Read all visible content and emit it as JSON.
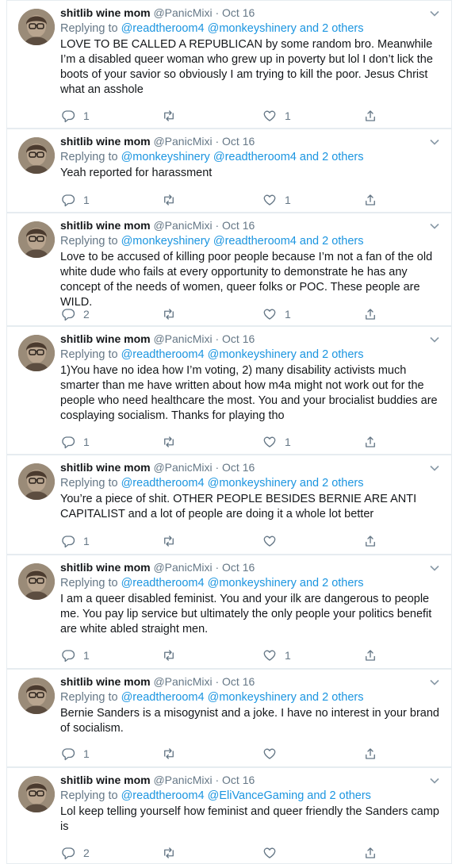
{
  "tweets": [
    {
      "name": "shitlib wine mom",
      "handle": "@PanicMixi",
      "sep": "·",
      "date": "Oct 16",
      "replying_prefix": "Replying to",
      "replying_1": "@readtheroom4",
      "replying_2": "@monkeyshinery",
      "replying_and": "and",
      "replying_others": "2 others",
      "text": "LOVE TO BE CALLED A REPUBLICAN by some random bro. Meanwhile I’m a disabled queer woman who grew up in poverty but lol I don’t lick the boots of your savior so obviously I am trying to kill the poor. Jesus Christ what an asshole",
      "reply_count": "1",
      "retweet_count": "",
      "like_count": "1"
    },
    {
      "name": "shitlib wine mom",
      "handle": "@PanicMixi",
      "sep": "·",
      "date": "Oct 16",
      "replying_prefix": "Replying to",
      "replying_1": "@monkeyshinery",
      "replying_2": "@readtheroom4",
      "replying_and": "and",
      "replying_others": "2 others",
      "text": "Yeah reported for harassment",
      "reply_count": "1",
      "retweet_count": "",
      "like_count": "1"
    },
    {
      "name": "shitlib wine mom",
      "handle": "@PanicMixi",
      "sep": "·",
      "date": "Oct 16",
      "replying_prefix": "Replying to",
      "replying_1": "@monkeyshinery",
      "replying_2": "@readtheroom4",
      "replying_and": "and",
      "replying_others": "2 others",
      "text": "Love to be accused of killing poor people because I’m not a fan of the old white dude who fails at every opportunity to demonstrate he has any concept of the needs of women, queer folks or POC. These people are WILD.",
      "reply_count": "2",
      "retweet_count": "",
      "like_count": "1"
    },
    {
      "name": "shitlib wine mom",
      "handle": "@PanicMixi",
      "sep": "·",
      "date": "Oct 16",
      "replying_prefix": "Replying to",
      "replying_1": "@readtheroom4",
      "replying_2": "@monkeyshinery",
      "replying_and": "and",
      "replying_others": "2 others",
      "text": "1)You have no idea how I’m voting, 2) many disability activists much smarter than me have written about how m4a might not work out for the people who need healthcare the most. You and your brocialist buddies are cosplaying socialism. Thanks for playing tho",
      "reply_count": "1",
      "retweet_count": "",
      "like_count": "1"
    },
    {
      "name": "shitlib wine mom",
      "handle": "@PanicMixi",
      "sep": "·",
      "date": "Oct 16",
      "replying_prefix": "Replying to",
      "replying_1": "@readtheroom4",
      "replying_2": "@monkeyshinery",
      "replying_and": "and",
      "replying_others": "2 others",
      "text": "You’re a piece of shit. OTHER PEOPLE BESIDES BERNIE ARE ANTI CAPITALIST and a lot of people are doing it a whole lot better",
      "reply_count": "1",
      "retweet_count": "",
      "like_count": ""
    },
    {
      "name": "shitlib wine mom",
      "handle": "@PanicMixi",
      "sep": "·",
      "date": "Oct 16",
      "replying_prefix": "Replying to",
      "replying_1": "@readtheroom4",
      "replying_2": "@monkeyshinery",
      "replying_and": "and",
      "replying_others": "2 others",
      "text": "I am a queer disabled feminist. You and your ilk are dangerous to people me. You pay lip service but ultimately the only people your politics benefit are white abled straight men.",
      "reply_count": "1",
      "retweet_count": "",
      "like_count": "1"
    },
    {
      "name": "shitlib wine mom",
      "handle": "@PanicMixi",
      "sep": "·",
      "date": "Oct 16",
      "replying_prefix": "Replying to",
      "replying_1": "@readtheroom4",
      "replying_2": "@monkeyshinery",
      "replying_and": "and",
      "replying_others": "2 others",
      "text": "Bernie Sanders is a misogynist and a joke. I have no interest in your brand of socialism.",
      "reply_count": "1",
      "retweet_count": "",
      "like_count": ""
    },
    {
      "name": "shitlib wine mom",
      "handle": "@PanicMixi",
      "sep": "·",
      "date": "Oct 16",
      "replying_prefix": "Replying to",
      "replying_1": "@readtheroom4",
      "replying_2": "@EliVanceGaming",
      "replying_and": "and",
      "replying_others": "2 others",
      "text": "Lol keep telling yourself how feminist and queer friendly the Sanders camp is",
      "reply_count": "2",
      "retweet_count": "",
      "like_count": ""
    }
  ],
  "icons": {
    "reply": "reply-icon",
    "retweet": "retweet-icon",
    "like": "heart-icon",
    "share": "share-icon",
    "menu": "chevron-down-icon"
  },
  "colors": {
    "link": "#1b95e0",
    "meta": "#657786",
    "text": "#14171a",
    "border": "#e6ecf0"
  }
}
